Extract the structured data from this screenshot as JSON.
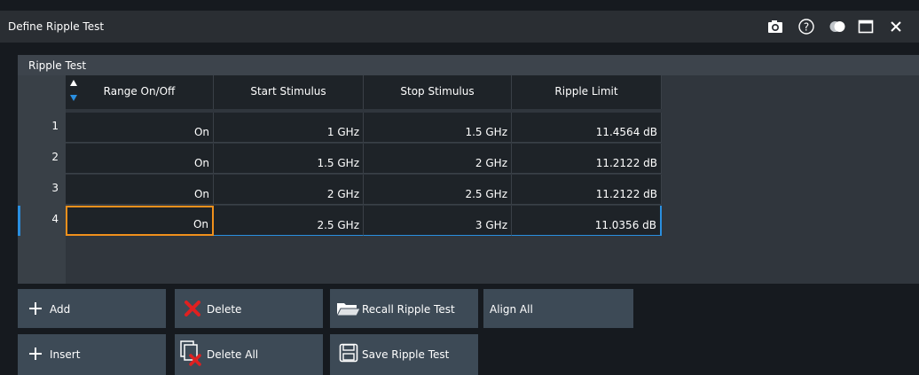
{
  "window": {
    "title": "Define Ripple Test"
  },
  "panel": {
    "title": "Ripple Test"
  },
  "table": {
    "columns": [
      "Range On/Off",
      "Start Stimulus",
      "Stop Stimulus",
      "Ripple Limit"
    ],
    "rows": [
      {
        "num": "1",
        "range": "On",
        "start": "1 GHz",
        "stop": "1.5 GHz",
        "limit": "11.4564 dB"
      },
      {
        "num": "2",
        "range": "On",
        "start": "1.5 GHz",
        "stop": "2 GHz",
        "limit": "11.2122 dB"
      },
      {
        "num": "3",
        "range": "On",
        "start": "2 GHz",
        "stop": "2.5 GHz",
        "limit": "11.2122 dB"
      },
      {
        "num": "4",
        "range": "On",
        "start": "2.5 GHz",
        "stop": "3 GHz",
        "limit": "11.0356 dB"
      }
    ],
    "selected_row": "4"
  },
  "buttons": {
    "add": "Add",
    "insert": "Insert",
    "delete": "Delete",
    "delete_all": "Delete All",
    "recall": "Recall Ripple Test",
    "save": "Save Ripple Test",
    "align_all": "Align All"
  },
  "colors": {
    "selection": "#f0901c",
    "accent": "#2a8fe0",
    "delete_x": "#e02020"
  }
}
